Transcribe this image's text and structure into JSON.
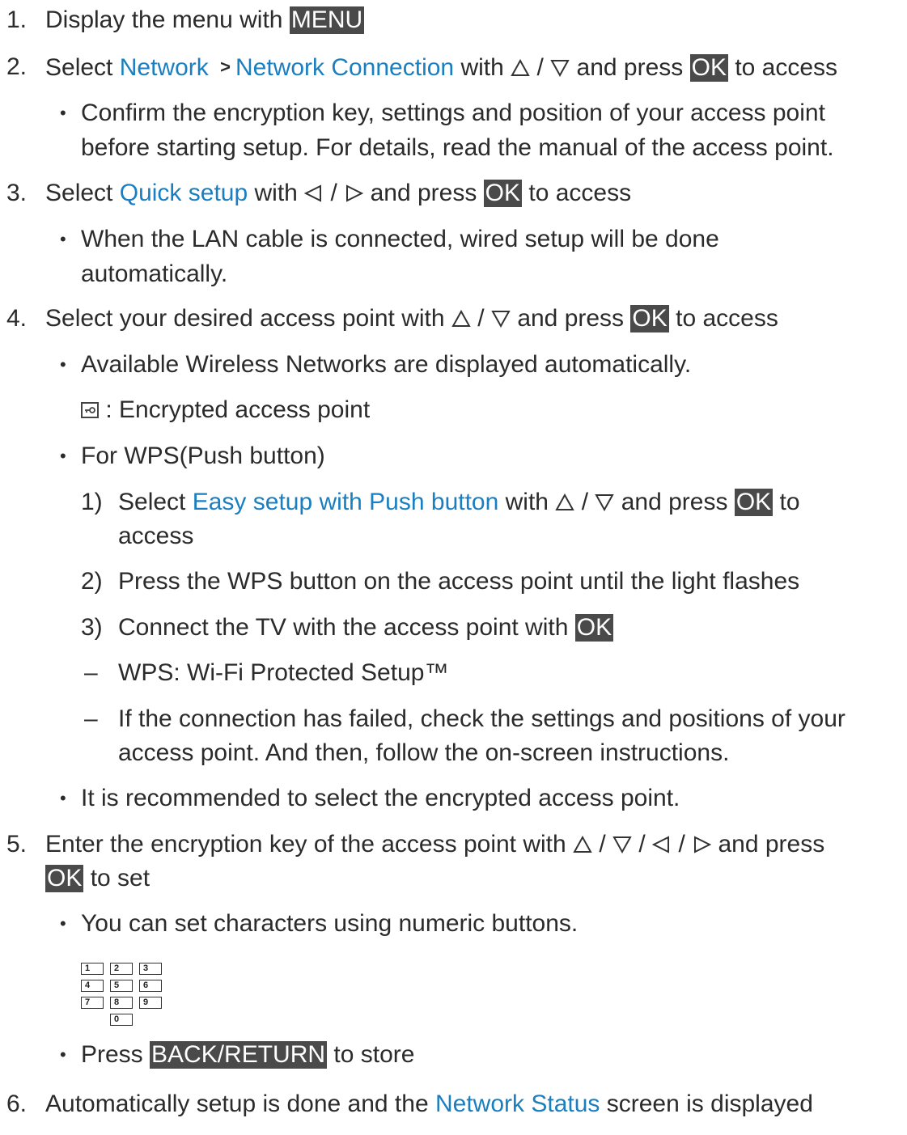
{
  "step1": {
    "num": "1.",
    "text": "Display the menu with",
    "key": "MENU"
  },
  "step2": {
    "num": "2.",
    "pre": "Select",
    "link1": "Network",
    "sep": ">",
    "link2": "Network Connection",
    "mid": "with",
    "slash": "/",
    "post": "and press",
    "key": "OK",
    "end": "to access"
  },
  "step2_note": {
    "line1": "Confirm the encryption key, settings and position of your access point",
    "line2": "before starting setup. For details, read the manual of the access point."
  },
  "step3": {
    "num": "3.",
    "pre": "Select",
    "link": "Quick setup",
    "mid": "with",
    "slash": "/",
    "post": "and press",
    "key": "OK",
    "end": "to access"
  },
  "step3_note": {
    "line1": "When the LAN cable is connected, wired setup will be done",
    "line2": "automatically."
  },
  "step4": {
    "num": "4.",
    "pre": "Select your desired access point with",
    "slash": "/",
    "post": "and press",
    "key": "OK",
    "end": "to access"
  },
  "step4_note1": "Available Wireless Networks are displayed automatically.",
  "step4_lock_label": ": Encrypted access point",
  "step4_note2": "For WPS(Push button)",
  "wps1": {
    "num": "1)",
    "pre": "Select",
    "link": "Easy setup with Push button",
    "mid": "with",
    "slash": "/",
    "post": "and press",
    "key": "OK",
    "end": "to",
    "line2": "access"
  },
  "wps2": {
    "num": "2)",
    "text": "Press the WPS button on the access point until the light flashes"
  },
  "wps3": {
    "num": "3)",
    "text": "Connect the TV with the access point with",
    "key": "OK"
  },
  "dash1": {
    "dash": "–",
    "text": "WPS: Wi-Fi Protected Setup™"
  },
  "dash2": {
    "dash": "–",
    "line1": "If the connection has failed, check the settings and positions of your",
    "line2": "access point. And then, follow the on-screen instructions."
  },
  "step4_note3": "It is recommended to select the encrypted access point.",
  "step5": {
    "num": "5.",
    "pre": "Enter the encryption key of the access point with",
    "slash": "/",
    "post": "and press",
    "key": "OK",
    "end": "to set"
  },
  "step5_note1": "You can set characters using numeric buttons.",
  "numpad_keys": [
    "1",
    "2",
    "3",
    "4",
    "5",
    "6",
    "7",
    "8",
    "9",
    "0"
  ],
  "step5_note2": {
    "pre": "Press",
    "key": "BACK/RETURN",
    "post": "to store"
  },
  "step6": {
    "num": "6.",
    "pre": "Automatically setup is done and the",
    "link": "Network Status",
    "post": "screen is displayed"
  },
  "bullet": "•",
  "colors": {
    "link": "#1a7fc0",
    "key_bg": "#4a4a4a",
    "text": "#2b2b2b"
  }
}
